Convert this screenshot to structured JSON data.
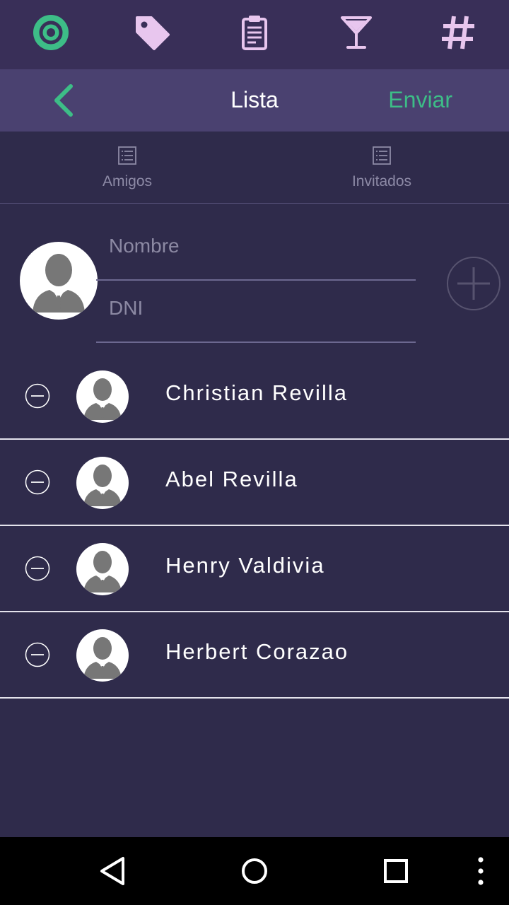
{
  "colors": {
    "top_bar": "#392f58",
    "header": "#4a4170",
    "background": "#2f2b4b",
    "accent_green": "#3dbd87",
    "icon_pink": "#e8c6ee"
  },
  "top_icons": [
    "target-icon",
    "tag-icon",
    "clipboard-icon",
    "cocktail-icon",
    "hashtag-icon"
  ],
  "header": {
    "title": "Lista",
    "send_label": "Enviar"
  },
  "tabs": [
    {
      "label": "Amigos",
      "icon": "list-icon"
    },
    {
      "label": "Invitados",
      "icon": "list-icon"
    }
  ],
  "form": {
    "name_placeholder": "Nombre",
    "dni_placeholder": "DNI",
    "name_value": "",
    "dni_value": ""
  },
  "guests": [
    {
      "name": "Christian Revilla"
    },
    {
      "name": "Abel Revilla"
    },
    {
      "name": "Henry Valdivia"
    },
    {
      "name": "Herbert Corazao"
    }
  ]
}
